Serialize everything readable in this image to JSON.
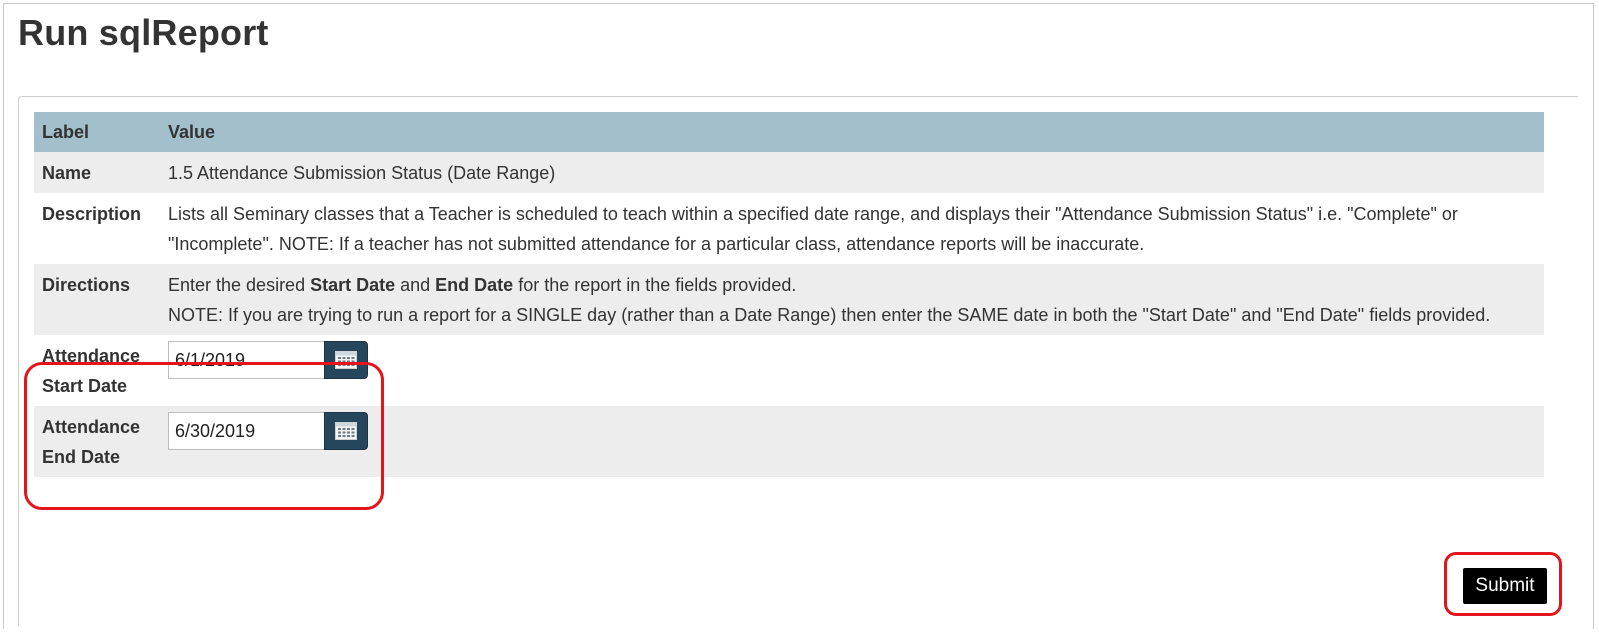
{
  "page": {
    "title": "Run sqlReport"
  },
  "table": {
    "headers": {
      "label": "Label",
      "value": "Value"
    },
    "name": {
      "label": "Name",
      "value": "1.5 Attendance Submission Status (Date Range)"
    },
    "description": {
      "label": "Description",
      "value": "Lists all Seminary classes that a Teacher is scheduled to teach within a specified date range, and displays their \"Attendance Submission Status\" i.e. \"Complete\" or \"Incomplete\". NOTE: If a teacher has not submitted attendance for a particular class, attendance reports will be inaccurate."
    },
    "directions": {
      "label": "Directions",
      "line1_prefix": "Enter the desired ",
      "start_bold": "Start Date",
      "and_text": " and ",
      "end_bold": "End Date",
      "line1_suffix": " for the report in the fields provided.",
      "note": "NOTE: If you are trying to run a report for a SINGLE day (rather than a Date Range) then enter the SAME date in both the \"Start Date\" and \"End Date\" fields provided."
    }
  },
  "params": {
    "start": {
      "label_line1": "Attendance",
      "label_line2": "Start Date",
      "value": "6/1/2019",
      "icon": "calendar-icon"
    },
    "end": {
      "label_line1": "Attendance",
      "label_line2": "End Date",
      "value": "6/30/2019",
      "icon": "calendar-icon"
    }
  },
  "actions": {
    "submit_label": "Submit"
  },
  "colors": {
    "header_bg": "#a3bfcb",
    "row_shade": "#ededed",
    "calendar_button": "#26465c",
    "highlight": "#e3141b",
    "submit_bg": "#000000"
  }
}
